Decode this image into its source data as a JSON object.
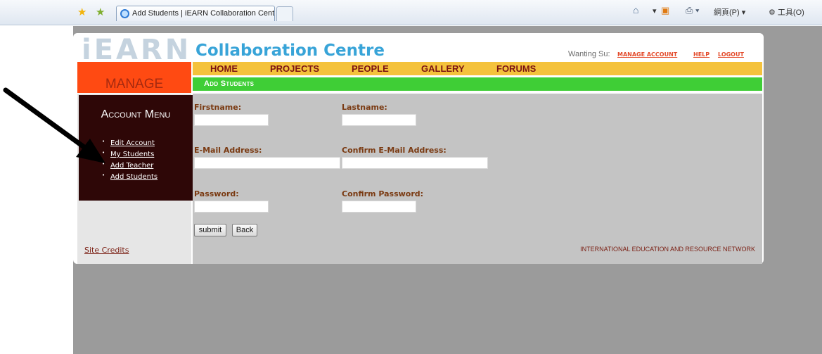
{
  "browser": {
    "tab_title": "Add Students | iEARN Collaboration Center",
    "command_page": "網頁(P) ▾",
    "command_tools": "⚙ 工具(O)"
  },
  "site": {
    "logo_text": "iEARN",
    "title": "Collaboration Centre",
    "user_name": "Wanting Su:",
    "user_links": {
      "manage_account": "MANAGE ACCOUNT",
      "help": "HELP",
      "logout": "LOGOUT"
    },
    "manage_label": "MANAGE",
    "nav": {
      "home": "HOME",
      "projects": "PROJECTS",
      "people": "PEOPLE",
      "gallery": "GALLERY",
      "forums": "FORUMS"
    },
    "section_title": "Add Students",
    "account_menu": {
      "title": "Account Menu",
      "items": [
        "Edit Account",
        "My Students",
        "Add Teacher",
        "Add Students"
      ]
    },
    "site_credits": "Site Credits",
    "footer": "INTERNATIONAL EDUCATION AND RESOURCE NETWORK"
  },
  "form": {
    "firstname_label": "Firstname:",
    "firstname_value": "",
    "lastname_label": "Lastname:",
    "lastname_value": "",
    "email_label": "E-Mail Address:",
    "email_value": "",
    "confirm_email_label": "Confirm E-Mail Address:",
    "confirm_email_value": "",
    "password_label": "Password:",
    "password_value": "",
    "confirm_password_label": "Confirm Password:",
    "confirm_password_value": "",
    "submit_label": "submit",
    "back_label": "Back"
  },
  "colors": {
    "nav_bar": "#f4c23c",
    "section_bar": "#3fce36",
    "manage_box": "#ff4a12",
    "menu_box": "#2e0707",
    "title_blue": "#38a4d8"
  }
}
